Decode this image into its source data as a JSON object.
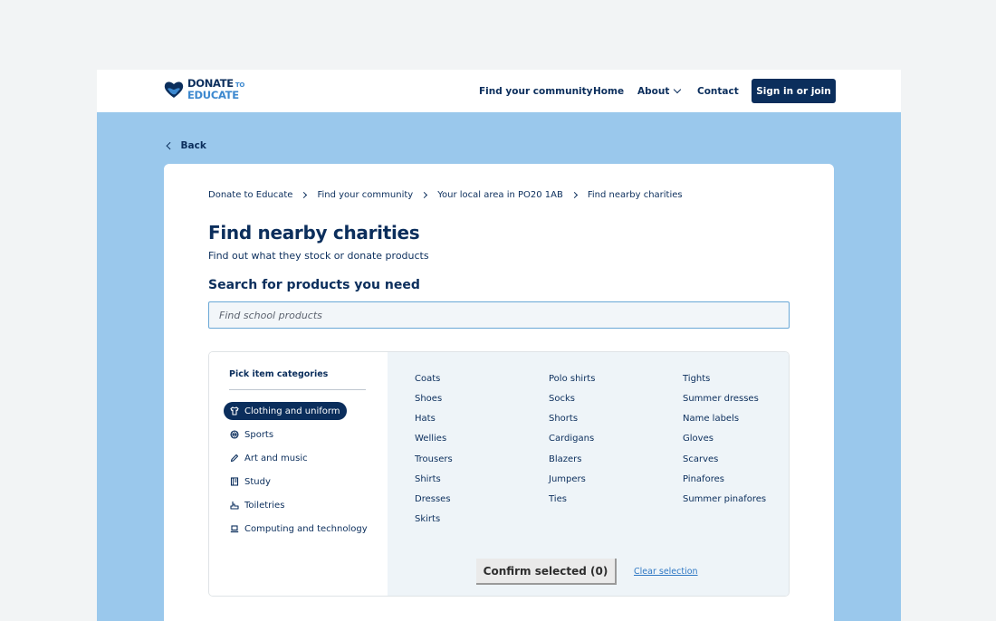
{
  "brand": {
    "line1": "DONATE",
    "line1_small": "TO",
    "line2": "EDUCATE",
    "colors": {
      "navy": "#0b2e5c",
      "blue": "#3c88cf",
      "banner": "#9ac8ec"
    }
  },
  "nav": {
    "find_community": "Find your community",
    "home": "Home",
    "about": "About",
    "contact": "Contact",
    "signin": "Sign in or join"
  },
  "back": "Back",
  "breadcrumb": [
    "Donate to Educate",
    "Find your community",
    "Your local area in PO20 1AB",
    "Find nearby charities"
  ],
  "page": {
    "title": "Find nearby charities",
    "subtitle": "Find out what they stock or donate products"
  },
  "search": {
    "heading": "Search for products you need",
    "placeholder": "Find school products",
    "value": ""
  },
  "categories": {
    "heading": "Pick item categories",
    "items": [
      {
        "label": "Clothing and uniform",
        "icon": "shirt-icon",
        "selected": true
      },
      {
        "label": "Sports",
        "icon": "ball-icon",
        "selected": false
      },
      {
        "label": "Art and music",
        "icon": "pencil-icon",
        "selected": false
      },
      {
        "label": "Study",
        "icon": "book-icon",
        "selected": false
      },
      {
        "label": "Toiletries",
        "icon": "toiletries-icon",
        "selected": false
      },
      {
        "label": "Computing and technology",
        "icon": "laptop-icon",
        "selected": false
      }
    ]
  },
  "products": {
    "col1": [
      "Coats",
      "Shoes",
      "Hats",
      "Wellies",
      "Trousers",
      "Shirts",
      "Dresses",
      "Skirts"
    ],
    "col2": [
      "Polo shirts",
      "Socks",
      "Shorts",
      "Cardigans",
      "Blazers",
      "Jumpers",
      "Ties"
    ],
    "col3": [
      "Tights",
      "Summer dresses",
      "Name labels",
      "Gloves",
      "Scarves",
      "Pinafores",
      "Summer pinafores"
    ]
  },
  "actions": {
    "confirm": "Confirm selected (0)",
    "clear": "Clear selection"
  }
}
